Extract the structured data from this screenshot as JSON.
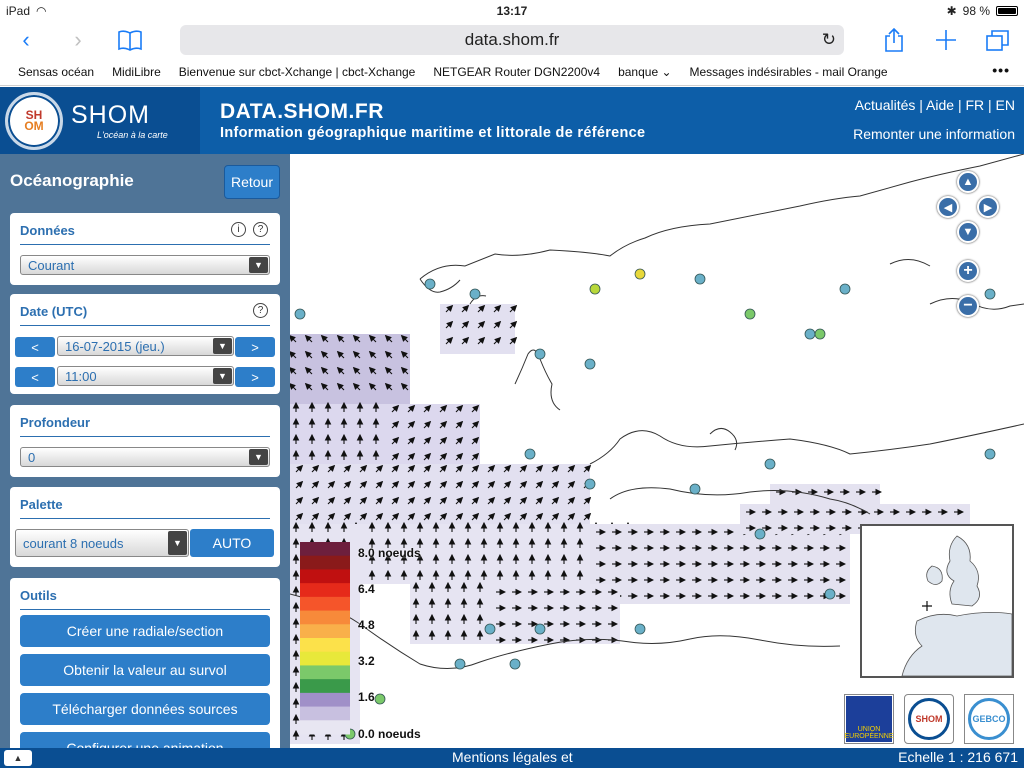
{
  "status": {
    "device": "iPad",
    "time": "13:17",
    "battery": "98 %"
  },
  "browser": {
    "url": "data.shom.fr"
  },
  "bookmarks": [
    "Sensas océan",
    "MidiLibre",
    "Bienvenue sur cbct-Xchange | cbct-Xchange",
    "NETGEAR Router DGN2200v4",
    "banque ⌄",
    "Messages indésirables - mail Orange"
  ],
  "site": {
    "logo_name": "SHOM",
    "logo_tagline": "L'océan à la carte",
    "title": "DATA.SHOM.FR",
    "subtitle": "Information géographique maritime et littorale de référence",
    "links": "Actualités | Aide | FR | EN",
    "report": "Remonter une information"
  },
  "sidebar": {
    "title": "Océanographie",
    "back_label": "Retour",
    "donnees": {
      "title": "Données",
      "value": "Courant"
    },
    "date": {
      "title": "Date (UTC)",
      "day": "16-07-2015 (jeu.)",
      "hour": "11:00",
      "prev": "<",
      "next": ">"
    },
    "profondeur": {
      "title": "Profondeur",
      "value": "0"
    },
    "palette": {
      "title": "Palette",
      "value": "courant 8 noeuds",
      "auto_label": "AUTO"
    },
    "outils": {
      "title": "Outils",
      "buttons": [
        "Créer une radiale/section",
        "Obtenir la valeur au survol",
        "Télécharger données sources",
        "Configurer une animation"
      ]
    }
  },
  "legend": {
    "labels": [
      "8.0 noeuds",
      "6.4",
      "4.8",
      "3.2",
      "1.6",
      "0.0 noeuds"
    ],
    "colors": [
      "#6d1f3d",
      "#8a1a1a",
      "#c01010",
      "#e62a1a",
      "#f5552a",
      "#f78a3a",
      "#f9b04a",
      "#fce14a",
      "#e8e83a",
      "#7bc96a",
      "#3a9a4a",
      "#a090c8",
      "#c8c0e0",
      "#e8e6f2"
    ]
  },
  "partners": [
    "UNION EUROPÉENNE",
    "SHOM",
    "GEBCO"
  ],
  "footer": {
    "mentions": "Mentions légales et",
    "scale": "Echelle 1 : 216 671"
  }
}
